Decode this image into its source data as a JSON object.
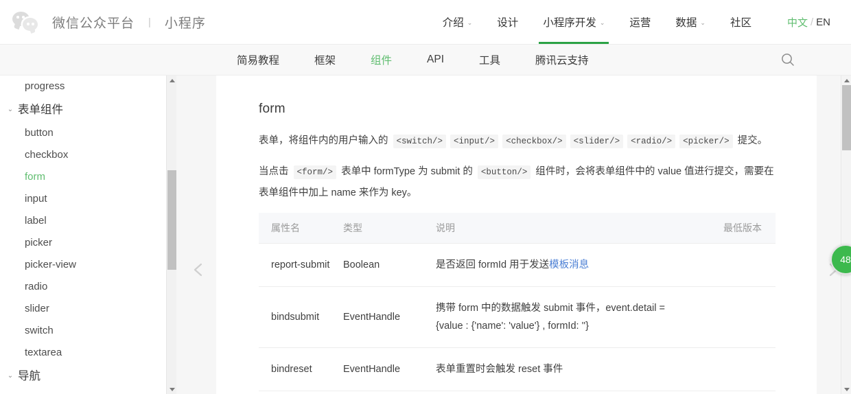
{
  "header": {
    "logo_name": "wechat-logo",
    "brand_title": "微信公众平台",
    "brand_separator": "|",
    "brand_sub": "小程序",
    "nav": [
      {
        "label": "介绍",
        "has_caret": true,
        "active": false,
        "caret": "⌄"
      },
      {
        "label": "设计",
        "has_caret": false,
        "active": false,
        "caret": ""
      },
      {
        "label": "小程序开发",
        "has_caret": true,
        "active": true,
        "caret": "⌄"
      },
      {
        "label": "运营",
        "has_caret": false,
        "active": false,
        "caret": ""
      },
      {
        "label": "数据",
        "has_caret": true,
        "active": false,
        "caret": "⌄"
      },
      {
        "label": "社区",
        "has_caret": false,
        "active": false,
        "caret": ""
      }
    ],
    "lang": {
      "zh": "中文",
      "slash": "/",
      "en": "EN"
    }
  },
  "subnav": {
    "items": [
      {
        "label": "简易教程",
        "active": false
      },
      {
        "label": "框架",
        "active": false
      },
      {
        "label": "组件",
        "active": true
      },
      {
        "label": "API",
        "active": false
      },
      {
        "label": "工具",
        "active": false
      },
      {
        "label": "腾讯云支持",
        "active": false
      }
    ],
    "search_icon": "search-icon"
  },
  "sidebar": {
    "items": [
      {
        "type": "item",
        "label": "progress",
        "active": false
      },
      {
        "type": "group",
        "label": "表单组件",
        "chevron": "⌄"
      },
      {
        "type": "item",
        "label": "button",
        "active": false
      },
      {
        "type": "item",
        "label": "checkbox",
        "active": false
      },
      {
        "type": "item",
        "label": "form",
        "active": true
      },
      {
        "type": "item",
        "label": "input",
        "active": false
      },
      {
        "type": "item",
        "label": "label",
        "active": false
      },
      {
        "type": "item",
        "label": "picker",
        "active": false
      },
      {
        "type": "item",
        "label": "picker-view",
        "active": false
      },
      {
        "type": "item",
        "label": "radio",
        "active": false
      },
      {
        "type": "item",
        "label": "slider",
        "active": false
      },
      {
        "type": "item",
        "label": "switch",
        "active": false
      },
      {
        "type": "item",
        "label": "textarea",
        "active": false
      },
      {
        "type": "group",
        "label": "导航",
        "chevron": "⌄"
      }
    ]
  },
  "carousel": {
    "prev_icon": "chevron-left-icon",
    "next_icon": "chevron-right-icon"
  },
  "doc": {
    "title": "form",
    "paragraph1": [
      {
        "t": "text",
        "v": "表单，将组件内的用户输入的 "
      },
      {
        "t": "code",
        "v": "<switch/>"
      },
      {
        "t": "code",
        "v": "<input/>"
      },
      {
        "t": "code",
        "v": "<checkbox/>"
      },
      {
        "t": "code",
        "v": "<slider/>"
      },
      {
        "t": "code",
        "v": "<radio/>"
      },
      {
        "t": "code",
        "v": "<picker/>"
      },
      {
        "t": "text",
        "v": " 提交。"
      }
    ],
    "paragraph2": [
      {
        "t": "text",
        "v": "当点击 "
      },
      {
        "t": "code",
        "v": "<form/>"
      },
      {
        "t": "text",
        "v": " 表单中 formType 为 submit 的 "
      },
      {
        "t": "code",
        "v": "<button/>"
      },
      {
        "t": "text",
        "v": " 组件时，会将表单组件中的 value 值进行提交，需要在表单组件中加上 name 来作为 key。"
      }
    ],
    "table": {
      "headers": [
        "属性名",
        "类型",
        "说明",
        "最低版本"
      ],
      "rows": [
        {
          "name": "report-submit",
          "type": "Boolean",
          "desc_pre": "是否返回 formId 用于发送",
          "desc_link": "模板消息",
          "desc_post": "",
          "version": ""
        },
        {
          "name": "bindsubmit",
          "type": "EventHandle",
          "desc_pre": "携带 form 中的数据触发 submit 事件，event.detail = {value : {'name': 'value'} , formId: ''}",
          "desc_link": "",
          "desc_post": "",
          "version": ""
        },
        {
          "name": "bindreset",
          "type": "EventHandle",
          "desc_pre": "表单重置时会触发 reset 事件",
          "desc_link": "",
          "desc_post": "",
          "version": ""
        }
      ]
    }
  },
  "float_badge": {
    "label": "48"
  },
  "scrollbars": {
    "sidebar": {
      "up_icon": "triangle-up-icon",
      "down_icon": "triangle-down-icon"
    },
    "page": {
      "up_icon": "triangle-up-icon",
      "down_icon": "triangle-down-icon"
    }
  },
  "colors": {
    "accent_green": "#5fbd6f",
    "active_underline": "#2ba245",
    "link_blue": "#4b7fd4",
    "badge_green": "#3cb94d",
    "body_bg": "#f6f6f6",
    "subnav_bg": "#f8f8f8",
    "table_head_bg": "#f7f8fa"
  }
}
